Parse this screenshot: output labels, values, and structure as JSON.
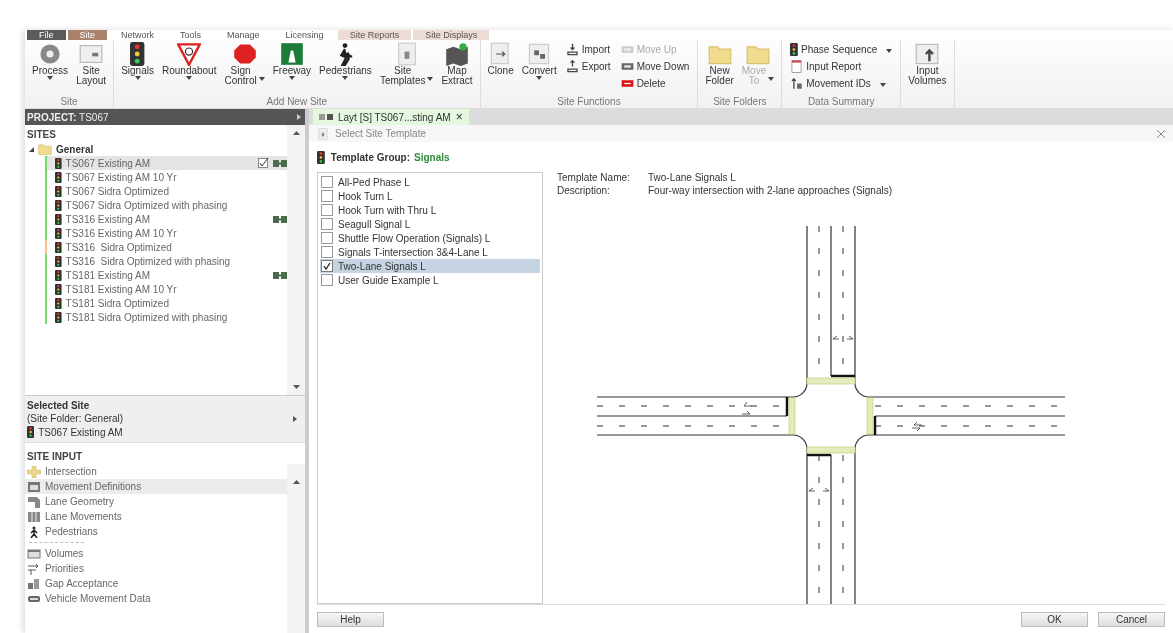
{
  "menu_tabs": [
    {
      "label": "File",
      "color": "#5b5b5b"
    },
    {
      "label": "Site",
      "color": "#a9826c"
    },
    {
      "label": "Network",
      "color": "#ffffff"
    },
    {
      "label": "Tools",
      "color": "#ffffff"
    },
    {
      "label": "Manage",
      "color": "#ffffff"
    },
    {
      "label": "Licensing",
      "color": "#ffffff"
    },
    {
      "label": "Site Reports",
      "color": "#eddcd6"
    },
    {
      "label": "Site Displays",
      "color": "#eddcd6"
    }
  ],
  "ribbon_groups": [
    {
      "label": "Site",
      "items": [
        {
          "kind": "gear",
          "label": "Process",
          "dropdown": true,
          "disabled": false
        },
        {
          "kind": "layout",
          "label": "Site Layout",
          "disabled": false
        }
      ]
    },
    {
      "label": "Add New Site",
      "items": [
        {
          "kind": "signals",
          "label": "Signals",
          "dropdown": true,
          "disabled": false
        },
        {
          "kind": "roundabout",
          "label": "Roundabout",
          "dropdown": true,
          "disabled": false
        },
        {
          "kind": "stop",
          "label": "Sign Control",
          "dropdown": true,
          "disabled": false
        },
        {
          "kind": "freeway",
          "label": "Freeway",
          "dropdown": true,
          "disabled": false
        },
        {
          "kind": "walker",
          "label": "Pedestrians",
          "dropdown": true,
          "disabled": false
        },
        {
          "kind": "templates",
          "label": "Site Templates",
          "dropdown": true,
          "disabled": false
        },
        {
          "kind": "map",
          "label": "Map Extract",
          "disabled": false
        }
      ]
    },
    {
      "label": "Site Functions",
      "items": [
        {
          "kind": "clone",
          "label": "Clone",
          "disabled": false
        },
        {
          "kind": "convert",
          "label": "Convert",
          "dropdown": true,
          "disabled": false
        },
        {
          "stack": [
            {
              "kind": "import",
              "label": "Import",
              "disabled": false
            },
            {
              "kind": "export",
              "label": "Export",
              "disabled": false
            }
          ]
        },
        {
          "stack": [
            {
              "kind": "moveup",
              "label": "Move Up",
              "disabled": true
            },
            {
              "kind": "movedown",
              "label": "Move Down",
              "disabled": false
            },
            {
              "kind": "delete",
              "label": "Delete",
              "disabled": false
            }
          ]
        }
      ]
    },
    {
      "label": "Site Folders",
      "items": [
        {
          "kind": "folder",
          "label": "New Folder",
          "disabled": false
        },
        {
          "kind": "folder",
          "label": "Move To",
          "dropdown": true,
          "disabled": true
        }
      ]
    },
    {
      "label": "Data Summary",
      "items": [
        {
          "stack": [
            {
              "kind": "signals",
              "label": "Phase Sequence",
              "dropdown": true,
              "disabled": false
            },
            {
              "kind": "report",
              "label": "Input Report",
              "disabled": false
            },
            {
              "kind": "ids",
              "label": "Movement IDs",
              "dropdown": true,
              "disabled": false
            }
          ]
        }
      ]
    },
    {
      "items": [
        {
          "kind": "volumes",
          "label": "Input Volumes",
          "disabled": false
        }
      ]
    }
  ],
  "project": {
    "label": "PROJECT:",
    "value": "TS067"
  },
  "sites": {
    "heading": "SITES",
    "folder": {
      "name": "General",
      "expanded": true
    },
    "items": [
      {
        "name": "TS067 Existing AM",
        "selected": true,
        "color": "#6fe06f",
        "checked": true,
        "linked": true
      },
      {
        "name": "TS067 Existing AM 10 Yr",
        "selected": false,
        "color": "#6fe06f"
      },
      {
        "name": "TS067 Sidra Optimized",
        "selected": false,
        "color": "#6fe06f"
      },
      {
        "name": "TS067 Sidra Optimized with phasing",
        "selected": false,
        "color": "#6fe06f"
      },
      {
        "name": "TS316 Existing AM",
        "selected": false,
        "color": "#6fe06f",
        "linked": true
      },
      {
        "name": "TS316 Existing AM 10 Yr",
        "selected": false,
        "color": "#6fe06f"
      },
      {
        "name": "TS316  Sidra Optimized",
        "selected": false,
        "color": "#f6c08e"
      },
      {
        "name": "TS316  Sidra Optimized with phasing",
        "selected": false,
        "color": "#6fe06f"
      },
      {
        "name": "TS181 Existing AM",
        "selected": false,
        "color": "#6fe06f",
        "linked": true
      },
      {
        "name": "TS181 Existing AM 10 Yr",
        "selected": false,
        "color": "#6fe06f"
      },
      {
        "name": "TS181 Sidra Optimized",
        "selected": false,
        "color": "#6fe06f"
      },
      {
        "name": "TS181 Sidra Optimized with phasing",
        "selected": false,
        "color": "#6fe06f"
      }
    ]
  },
  "selected_site": {
    "heading": "Selected Site",
    "folder": "(Site Folder: General)",
    "name": "TS067 Existing AM"
  },
  "site_input": {
    "heading": "SITE INPUT",
    "groups": [
      [
        {
          "kind": "intersection",
          "label": "Intersection",
          "selected": false
        },
        {
          "kind": "movements",
          "label": "Movement Definitions",
          "selected": true
        },
        {
          "kind": "geometry",
          "label": "Lane Geometry",
          "selected": false
        },
        {
          "kind": "lanes",
          "label": "Lane Movements",
          "selected": false
        },
        {
          "kind": "pedestrians",
          "label": "Pedestrians",
          "selected": false
        }
      ],
      [
        {
          "kind": "volumes",
          "label": "Volumes",
          "selected": false
        },
        {
          "kind": "priorities",
          "label": "Priorities",
          "selected": false
        },
        {
          "kind": "gap",
          "label": "Gap Acceptance",
          "selected": false
        },
        {
          "kind": "vehicle",
          "label": "Vehicle Movement Data",
          "selected": false
        }
      ]
    ]
  },
  "doc_tab": {
    "label": "Layt [S] TS067...sting AM",
    "close": "×"
  },
  "dialog": {
    "title": "Select Site Template",
    "group_label": "Template Group:",
    "group_value": "Signals",
    "templates": [
      {
        "name": "All-Ped Phase L",
        "checked": false,
        "selected": false
      },
      {
        "name": "Hook Turn L",
        "checked": false,
        "selected": false
      },
      {
        "name": "Hook Turn with Thru L",
        "checked": false,
        "selected": false
      },
      {
        "name": "Seagull Signal L",
        "checked": false,
        "selected": false
      },
      {
        "name": "Shuttle Flow Operation (Signals) L",
        "checked": false,
        "selected": false
      },
      {
        "name": "Signals T-intersection 3&4-Lane L",
        "checked": false,
        "selected": false
      },
      {
        "name": "Two-Lane Signals L",
        "checked": true,
        "selected": true
      },
      {
        "name": "User Guide Example L",
        "checked": false,
        "selected": false
      }
    ],
    "details": [
      {
        "label": "Template Name:",
        "value": "Two-Lane Signals L"
      },
      {
        "label": "Description:",
        "value": "Four-way intersection with 2-lane approaches (Signals)"
      }
    ],
    "buttons": {
      "help": "Help",
      "ok": "OK",
      "cancel": "Cancel"
    }
  }
}
